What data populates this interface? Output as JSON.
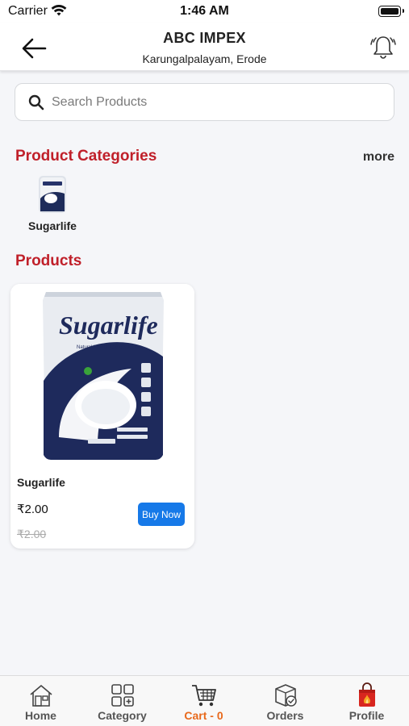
{
  "status_bar": {
    "carrier": "Carrier",
    "time": "1:46 AM"
  },
  "header": {
    "title": "ABC IMPEX",
    "subtitle": "Karungalpalayam, Erode",
    "back_icon": "arrow-left-icon",
    "bell_icon": "bell-ringing-icon"
  },
  "search": {
    "placeholder": "Search Products",
    "value": ""
  },
  "categories_section": {
    "title": "Product Categories",
    "more_label": "more",
    "items": [
      {
        "label": "Sugarlife",
        "icon": "sugarlife-pack-thumbnail"
      }
    ]
  },
  "products_section": {
    "title": "Products",
    "items": [
      {
        "name": "Sugarlife",
        "price": "₹2.00",
        "mrp": "₹2.00",
        "buy_label": "Buy Now",
        "image_text": "Sugarlife",
        "image_tagline": "Natural Low GI Cane Sugar"
      }
    ]
  },
  "tab_bar": {
    "items": [
      {
        "label": "Home",
        "icon": "home-icon",
        "active": false
      },
      {
        "label": "Category",
        "icon": "category-grid-icon",
        "active": false
      },
      {
        "label": "Cart - 0",
        "icon": "cart-icon",
        "active": true
      },
      {
        "label": "Orders",
        "icon": "orders-box-icon",
        "active": false
      },
      {
        "label": "Profile",
        "icon": "profile-bag-icon",
        "active": false
      }
    ]
  },
  "colors": {
    "accent_red": "#c0202a",
    "active_tab": "#e8691c",
    "button_blue": "#1679e8",
    "background": "#f5f6f9"
  }
}
